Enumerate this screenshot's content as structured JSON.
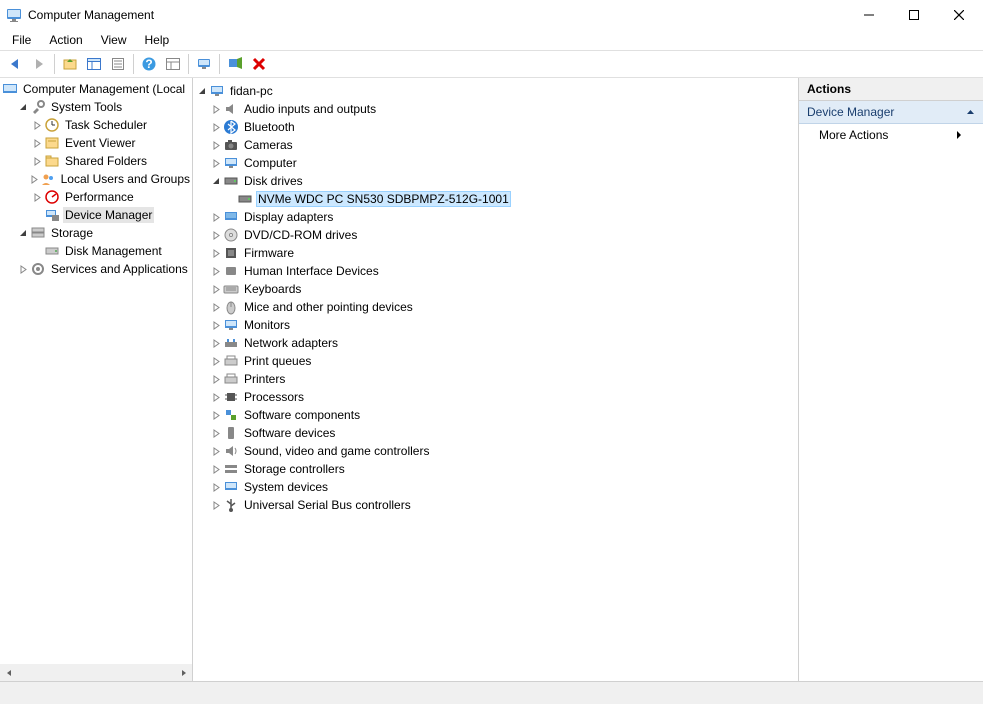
{
  "window": {
    "title": "Computer Management"
  },
  "menubar": {
    "file": "File",
    "action": "Action",
    "view": "View",
    "help": "Help"
  },
  "left_tree": {
    "root": "Computer Management (Local",
    "system_tools": "System Tools",
    "task_scheduler": "Task Scheduler",
    "event_viewer": "Event Viewer",
    "shared_folders": "Shared Folders",
    "local_users": "Local Users and Groups",
    "performance": "Performance",
    "device_manager": "Device Manager",
    "storage": "Storage",
    "disk_management": "Disk Management",
    "services_apps": "Services and Applications"
  },
  "center_tree": {
    "root": "fidan-pc",
    "audio": "Audio inputs and outputs",
    "bluetooth": "Bluetooth",
    "cameras": "Cameras",
    "computer": "Computer",
    "disk_drives": "Disk drives",
    "nvme": "NVMe WDC PC SN530 SDBPMPZ-512G-1001",
    "display": "Display adapters",
    "dvd": "DVD/CD-ROM drives",
    "firmware": "Firmware",
    "hid": "Human Interface Devices",
    "keyboards": "Keyboards",
    "mice": "Mice and other pointing devices",
    "monitors": "Monitors",
    "network": "Network adapters",
    "print_queues": "Print queues",
    "printers": "Printers",
    "processors": "Processors",
    "sw_components": "Software components",
    "sw_devices": "Software devices",
    "sound": "Sound, video and game controllers",
    "storage_ctrl": "Storage controllers",
    "system_devices": "System devices",
    "usb": "Universal Serial Bus controllers"
  },
  "actions": {
    "header": "Actions",
    "section": "Device Manager",
    "more": "More Actions"
  }
}
